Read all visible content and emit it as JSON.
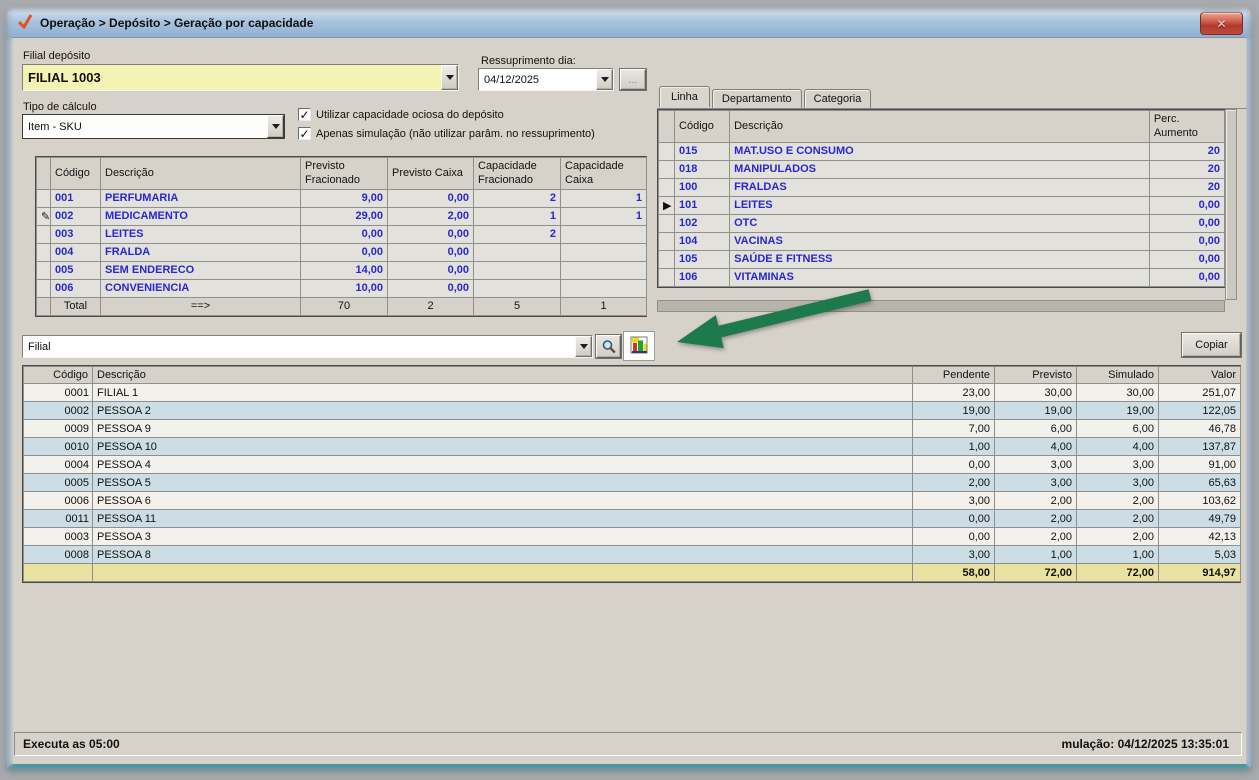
{
  "window": {
    "title": "Operação > Depósito > Geração por capacidade"
  },
  "header": {
    "filial_label": "Filial depósito",
    "filial_value": "FILIAL 1003",
    "ressup_label": "Ressuprimento dia:",
    "ressup_value": "04/12/2025",
    "more_button": "...",
    "tipo_label": "Tipo de cálculo",
    "tipo_value": "Item - SKU",
    "checkboxes": [
      {
        "label": "Utilizar capacidade ociosa do depósito",
        "checked": true
      },
      {
        "label": "Apenas simulação (não utilizar parâm. no ressuprimento)",
        "checked": true
      }
    ]
  },
  "capacity_grid": {
    "headers": {
      "codigo": "Código",
      "descricao": "Descrição",
      "prev_frac": "Previsto Fracionado",
      "prev_caixa": "Previsto Caixa",
      "cap_frac": "Capacidade Fracionado",
      "cap_caixa": "Capacidade Caixa"
    },
    "rows": [
      [
        "001",
        "PERFUMARIA",
        "9,00",
        "0,00",
        "2",
        "1"
      ],
      [
        "002",
        "MEDICAMENTO",
        "29,00",
        "2,00",
        "1",
        "1"
      ],
      [
        "003",
        "LEITES",
        "0,00",
        "0,00",
        "2",
        ""
      ],
      [
        "004",
        "FRALDA",
        "0,00",
        "0,00",
        "",
        ""
      ],
      [
        "005",
        "SEM ENDERECO",
        "14,00",
        "0,00",
        "",
        ""
      ],
      [
        "006",
        "CONVENIENCIA",
        "10,00",
        "0,00",
        "",
        ""
      ]
    ],
    "edit_row_index": 1,
    "total": [
      "Total",
      "==>",
      "70",
      "2",
      "5",
      "1"
    ]
  },
  "tabs": {
    "items": [
      "Linha",
      "Departamento",
      "Categoria"
    ],
    "active_index": 0
  },
  "linha_grid": {
    "headers": {
      "codigo": "Código",
      "descricao": "Descrição",
      "perc": "Perc. Aumento"
    },
    "rows": [
      [
        "015",
        "MAT.USO E CONSUMO",
        "20"
      ],
      [
        "018",
        "MANIPULADOS",
        "20"
      ],
      [
        "100",
        "FRALDAS",
        "20"
      ],
      [
        "101",
        "LEITES",
        "0,00"
      ],
      [
        "102",
        "OTC",
        "0,00"
      ],
      [
        "104",
        "VACINAS",
        "0,00"
      ],
      [
        "105",
        "SAÚDE E FITNESS",
        "0,00"
      ],
      [
        "106",
        "VITAMINAS",
        "0,00"
      ]
    ],
    "selected_row_index": 3
  },
  "toolbar": {
    "group_combo_value": "Filial",
    "copy_button": "Copiar"
  },
  "result_grid": {
    "headers": [
      "Código",
      "Descrição",
      "Pendente",
      "Previsto",
      "Simulado",
      "Valor"
    ],
    "rows": [
      [
        "0001",
        "FILIAL 1",
        "23,00",
        "30,00",
        "30,00",
        "251,07"
      ],
      [
        "0002",
        "PESSOA 2",
        "19,00",
        "19,00",
        "19,00",
        "122,05"
      ],
      [
        "0009",
        "PESSOA 9",
        "7,00",
        "6,00",
        "6,00",
        "46,78"
      ],
      [
        "0010",
        "PESSOA 10",
        "1,00",
        "4,00",
        "4,00",
        "137,87"
      ],
      [
        "0004",
        "PESSOA 4",
        "0,00",
        "3,00",
        "3,00",
        "91,00"
      ],
      [
        "0005",
        "PESSOA 5",
        "2,00",
        "3,00",
        "3,00",
        "65,63"
      ],
      [
        "0006",
        "PESSOA 6",
        "3,00",
        "2,00",
        "2,00",
        "103,62"
      ],
      [
        "0011",
        "PESSOA 11",
        "0,00",
        "2,00",
        "2,00",
        "49,79"
      ],
      [
        "0003",
        "PESSOA 3",
        "0,00",
        "2,00",
        "2,00",
        "42,13"
      ],
      [
        "0008",
        "PESSOA 8",
        "3,00",
        "1,00",
        "1,00",
        "5,03"
      ]
    ],
    "totals": [
      "",
      "",
      "58,00",
      "72,00",
      "72,00",
      "914,97"
    ]
  },
  "status": {
    "left": "Executa as 05:00",
    "right": "mulação: 04/12/2025 13:35:01"
  },
  "icons": {
    "title_logo": "orange-checkmark",
    "close": "close-x",
    "dropdown": "triangle-down",
    "checkbox_check": "✓",
    "edit_pencil": "✎",
    "row_pointer": "▶",
    "search": "magnifier-glass",
    "chart": "colored-bar-chart",
    "annotation_arrow": "green-arrow-pointing-at-chart-button"
  },
  "colors": {
    "grid_text_blue": "#2727cf",
    "field_yellow": "#f4f3b4",
    "row_alt_blue": "#ccdde5",
    "totals_yellow": "#e9e2a0",
    "arrow_green": "#1d7a4c",
    "titlebar_blue": "#a9c3de",
    "close_red": "#b13a2e"
  }
}
